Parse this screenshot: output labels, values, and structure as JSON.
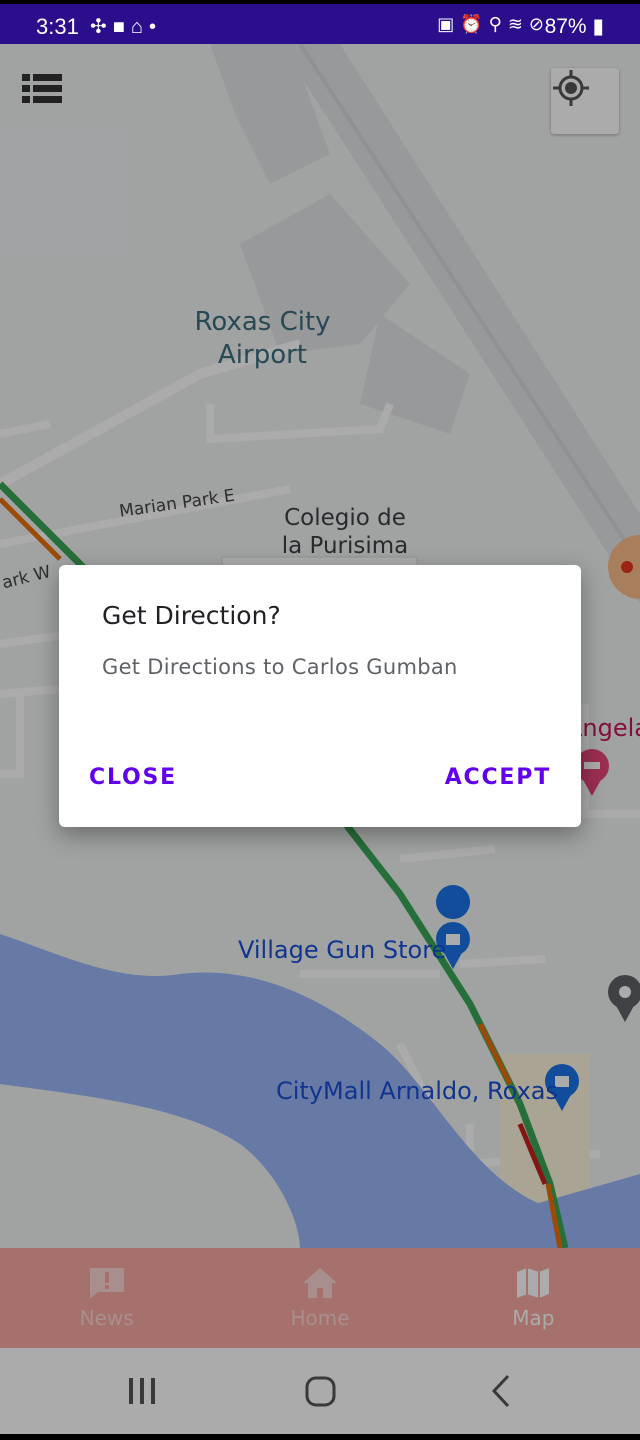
{
  "status_bar": {
    "time": "3:31",
    "left_icons": [
      "fan-icon",
      "video-icon",
      "home-icon",
      "dot-icon"
    ],
    "right_icons": [
      "bag-icon",
      "alarm-icon",
      "location-icon",
      "wifi-icon",
      "dnd-icon"
    ],
    "battery": "87%"
  },
  "map": {
    "labels": {
      "airport": "Roxas City\nAirport",
      "school": "Colegio de\nla Purisima",
      "road": "Marian Park E",
      "road2": "ark W",
      "gun_store": "Village Gun Store",
      "mall": "CityMall Arnaldo, Roxas",
      "angela": "Angela"
    },
    "accent_water": "#9ab6f8",
    "traffic_green": "#3aa657",
    "traffic_orange": "#e8710a",
    "traffic_red": "#c5221f"
  },
  "controls": {
    "menu_icon": "list-icon",
    "locate_icon": "my-location-icon"
  },
  "dialog": {
    "title": "Get Direction?",
    "message": "Get Directions to Carlos Gumban",
    "close_label": "CLOSE",
    "accept_label": "ACCEPT",
    "accent": "#6200ee"
  },
  "bottom_nav": {
    "items": [
      {
        "label": "News",
        "icon": "news-icon"
      },
      {
        "label": "Home",
        "icon": "home-icon"
      },
      {
        "label": "Map",
        "icon": "map-icon"
      }
    ],
    "active": "Map",
    "background": "#f8a7a3"
  },
  "system_nav": [
    "recents-icon",
    "home-circle-icon",
    "back-icon"
  ]
}
